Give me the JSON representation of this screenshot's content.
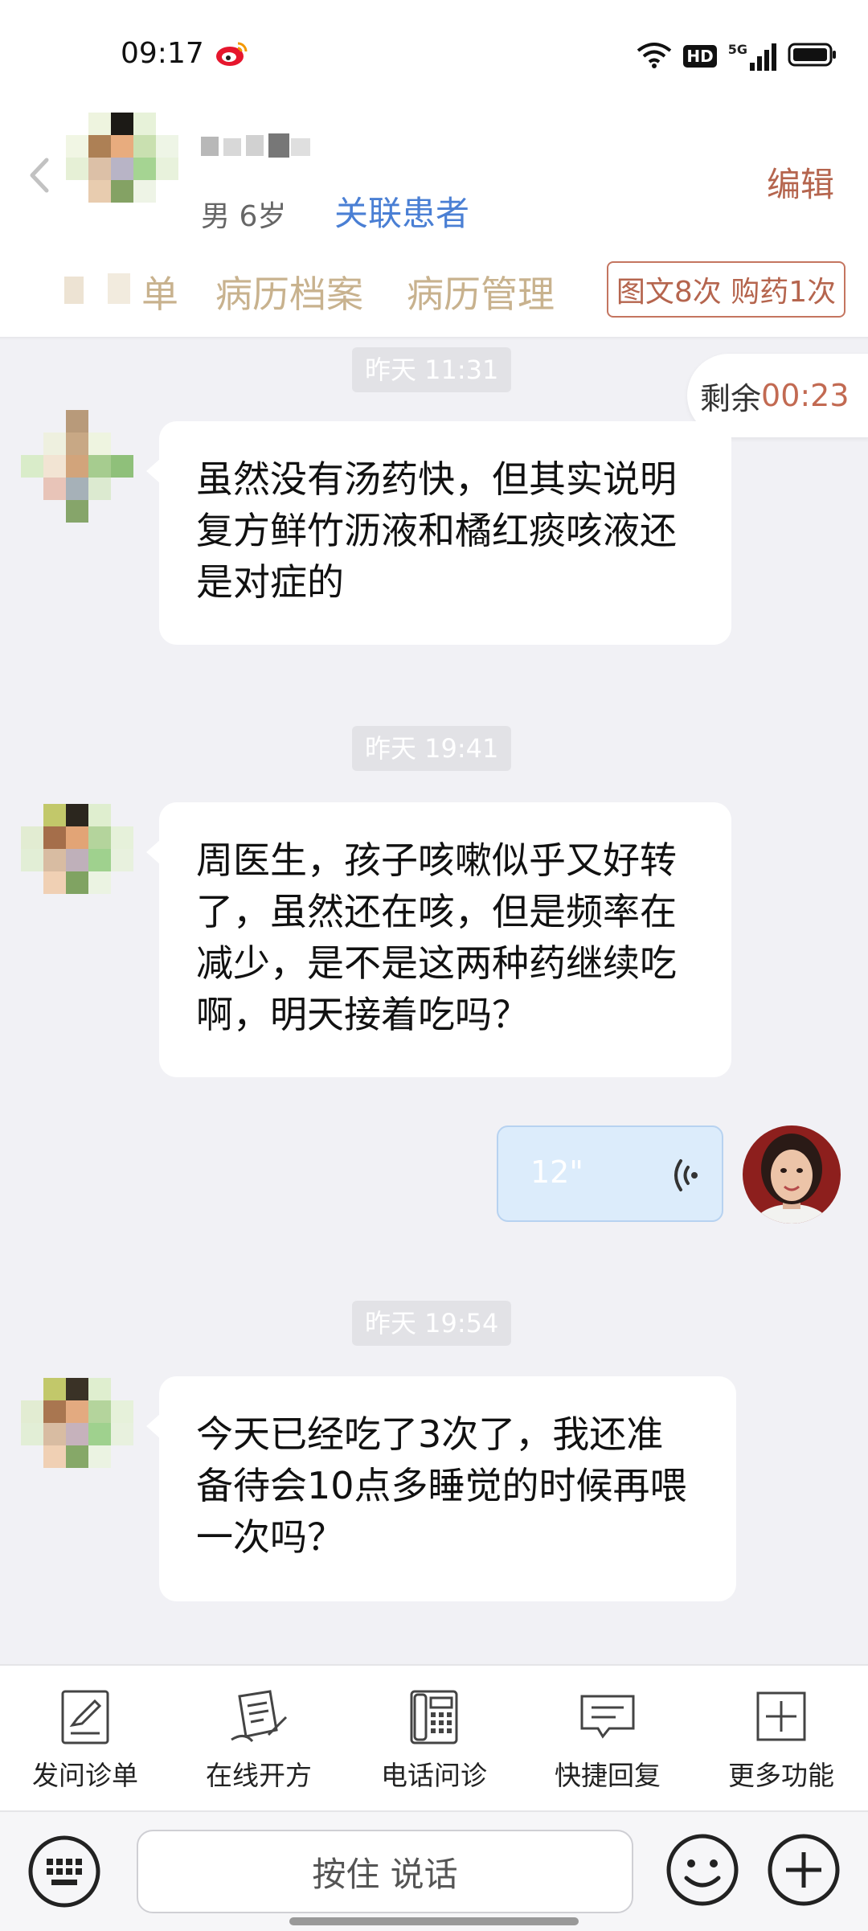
{
  "status_bar": {
    "time": "09:17",
    "icons": [
      "weibo-icon",
      "wifi-icon",
      "hd-icon",
      "5g-signal-icon",
      "battery-icon"
    ],
    "hd_label": "HD",
    "network_label": "5G"
  },
  "header": {
    "patient_info": "男 6岁",
    "link_patient": "关联患者",
    "edit": "编辑",
    "tabs": [
      {
        "label": "单"
      },
      {
        "label": "病历档案"
      },
      {
        "label": "病历管理"
      }
    ],
    "counter": "图文8次 购药1次"
  },
  "chat": {
    "remaining_label": "剩余",
    "remaining_time": "00:23",
    "messages": [
      {
        "timestamp": "昨天 11:31",
        "text": "虽然没有汤药快，但其实说明复方鲜竹沥液和橘红痰咳液还是对症的"
      },
      {
        "timestamp": "昨天 19:41",
        "text": "周医生，孩子咳嗽似乎又好转了，虽然还在咳，但是频率在减少，是不是这两种药继续吃啊，明天接着吃吗？"
      },
      {
        "voice_duration": "12\""
      },
      {
        "timestamp": "昨天 19:54",
        "text": "今天已经吃了3次了，我还准备待会10点多睡觉的时候再喂一次吗？"
      }
    ]
  },
  "toolbar": {
    "items": [
      {
        "label": "发问诊单",
        "icon": "questionnaire-icon"
      },
      {
        "label": "在线开方",
        "icon": "prescription-icon"
      },
      {
        "label": "电话问诊",
        "icon": "phone-consult-icon"
      },
      {
        "label": "快捷回复",
        "icon": "quick-reply-icon"
      },
      {
        "label": "更多功能",
        "icon": "more-functions-icon"
      }
    ]
  },
  "input_bar": {
    "talk_label": "按住 说话"
  },
  "colors": {
    "accent_link": "#4a7fd4",
    "accent_brown": "#b5654e",
    "tab_text": "#c8b28e",
    "voice_bubble": "#dcecfb"
  }
}
